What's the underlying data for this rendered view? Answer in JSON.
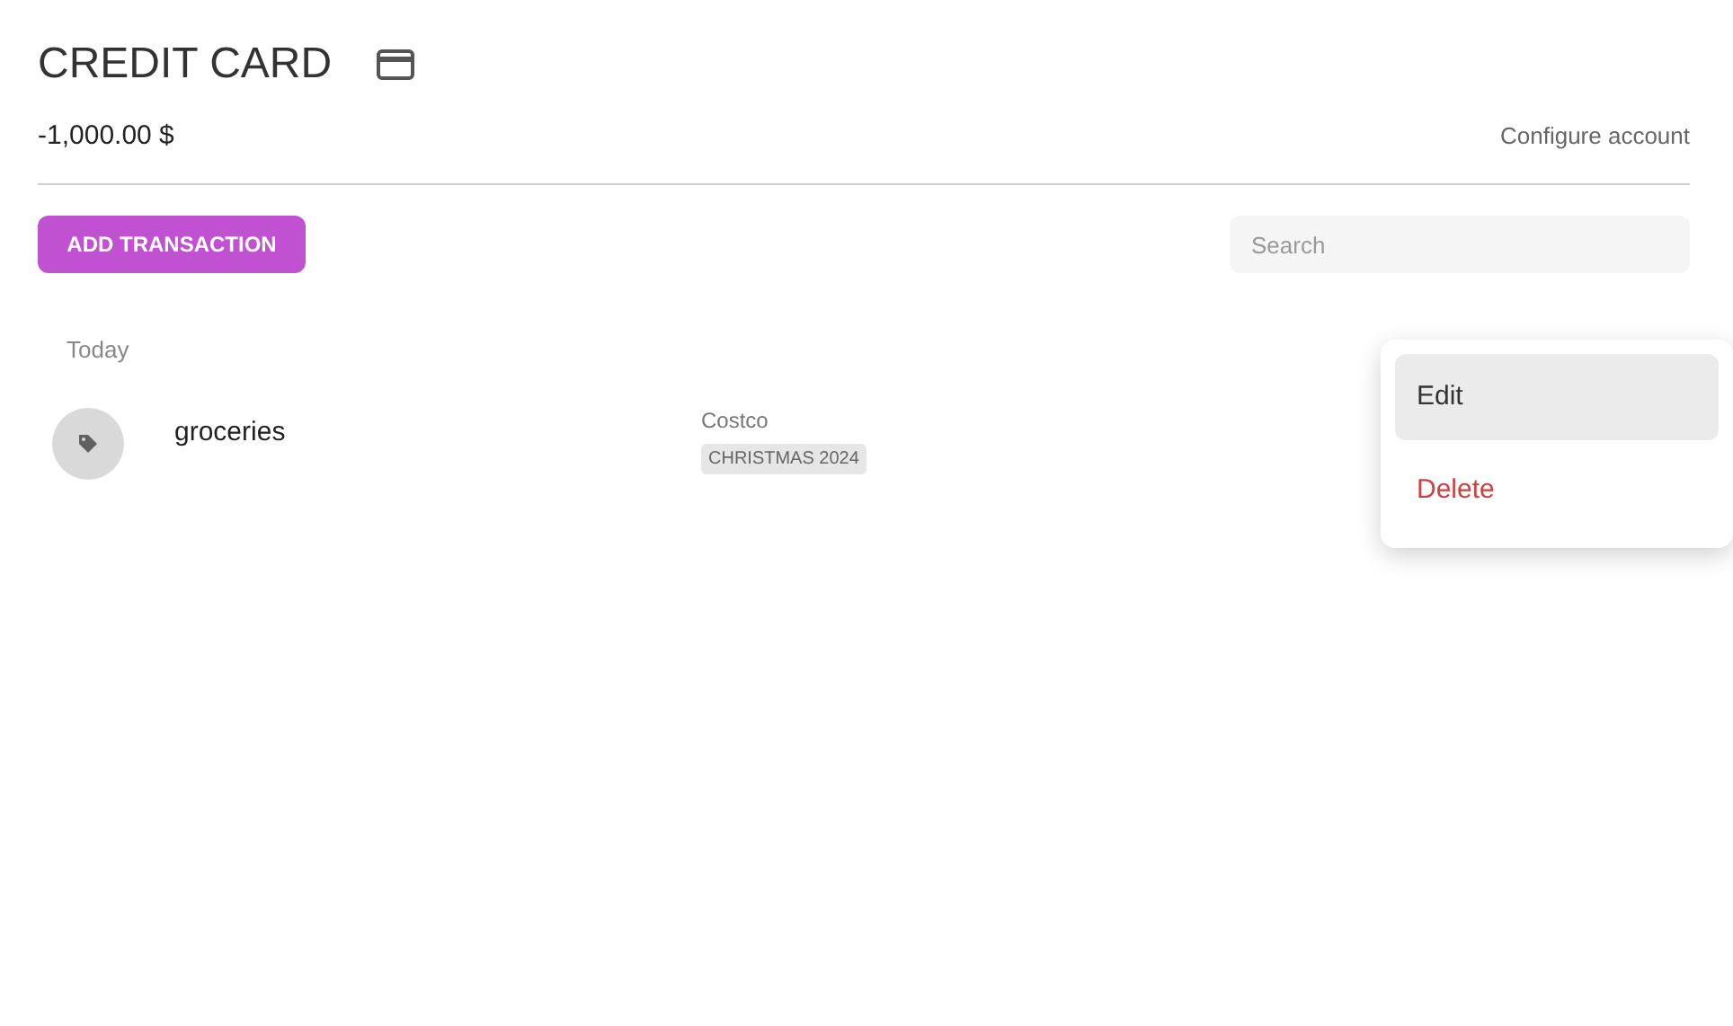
{
  "account": {
    "title": "CREDIT CARD",
    "balance": "-1,000.00 $",
    "configure_link": "Configure account"
  },
  "toolbar": {
    "add_button": "ADD TRANSACTION",
    "search": {
      "placeholder": "Search"
    }
  },
  "groups": [
    {
      "label": "Today",
      "transactions": [
        {
          "category": "groceries",
          "payee": "Costco",
          "tags": [
            "CHRISTMAS 2024"
          ]
        }
      ]
    }
  ],
  "context_menu": {
    "items": [
      {
        "label": "Edit",
        "kind": "default",
        "selected": true
      },
      {
        "label": "Delete",
        "kind": "danger",
        "selected": false
      }
    ]
  }
}
